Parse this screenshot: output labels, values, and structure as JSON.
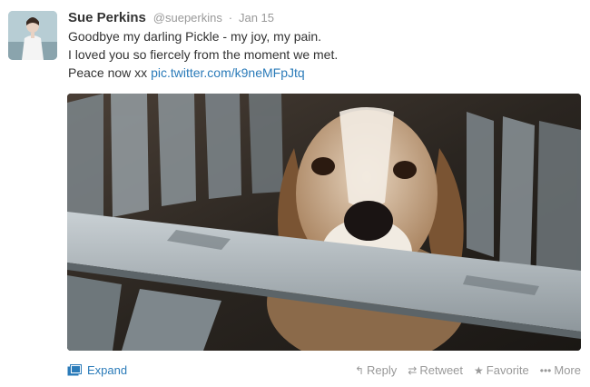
{
  "tweet": {
    "fullname": "Sue Perkins",
    "username": "@sueperkins",
    "separator": "·",
    "timestamp": "Jan 15",
    "text_lines": [
      "Goodbye my darling Pickle - my joy, my pain.",
      "I loved you so fiercely from the moment we met."
    ],
    "text_last_prefix": "Peace now xx ",
    "link_text": "pic.twitter.com/k9neMFpJtq"
  },
  "footer": {
    "expand_label": "Expand",
    "actions": [
      {
        "label": "Reply",
        "icon": "reply-icon"
      },
      {
        "label": "Retweet",
        "icon": "retweet-icon"
      },
      {
        "label": "Favorite",
        "icon": "star-icon"
      },
      {
        "label": "More",
        "icon": "more-icon"
      }
    ]
  },
  "colors": {
    "link": "#2b7bb9",
    "muted": "#999999",
    "text": "#333333"
  }
}
